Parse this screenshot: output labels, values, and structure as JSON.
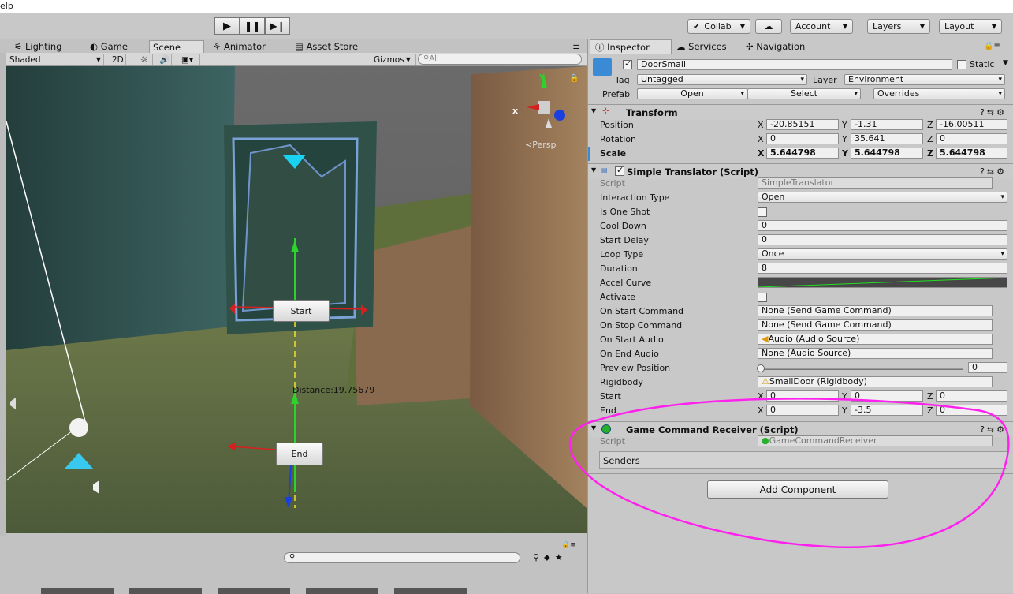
{
  "menubar": {
    "fragment": "elp"
  },
  "toolbar": {
    "collab": "Collab",
    "account": "Account",
    "layers": "Layers",
    "layout": "Layout"
  },
  "scene_tabs": [
    {
      "label": "Lighting"
    },
    {
      "label": "Game"
    },
    {
      "label": "Scene"
    },
    {
      "label": "Animator"
    },
    {
      "label": "Asset Store"
    }
  ],
  "scene_bar": {
    "shading": "Shaded",
    "mode_2d": "2D",
    "gizmos": "Gizmos",
    "search_placeholder": "All"
  },
  "viewport": {
    "persp": "Persp",
    "start_label": "Start",
    "end_label": "End",
    "distance": "Distance:19.75679",
    "gizmo_x": "x",
    "gizmo_y": "y"
  },
  "inspector_tabs": [
    {
      "label": "Inspector"
    },
    {
      "label": "Services"
    },
    {
      "label": "Navigation"
    }
  ],
  "object": {
    "name": "DoorSmall",
    "static_label": "Static",
    "tag_label": "Tag",
    "tag": "Untagged",
    "layer_label": "Layer",
    "layer": "Environment",
    "prefab_label": "Prefab",
    "open": "Open",
    "select": "Select",
    "overrides": "Overrides"
  },
  "transform": {
    "title": "Transform",
    "position_label": "Position",
    "rotation_label": "Rotation",
    "scale_label": "Scale",
    "position": {
      "x": "-20.85151",
      "y": "-1.31",
      "z": "-16.00511"
    },
    "rotation": {
      "x": "0",
      "y": "35.641",
      "z": "0"
    },
    "scale": {
      "x": "5.644798",
      "y": "5.644798",
      "z": "5.644798"
    }
  },
  "translator": {
    "title": "Simple Translator (Script)",
    "script_label": "Script",
    "script": "SimpleTranslator",
    "interaction_type_label": "Interaction Type",
    "interaction_type": "Open",
    "is_one_shot_label": "Is One Shot",
    "cool_down_label": "Cool Down",
    "cool_down": "0",
    "start_delay_label": "Start Delay",
    "start_delay": "0",
    "loop_type_label": "Loop Type",
    "loop_type": "Once",
    "duration_label": "Duration",
    "duration": "8",
    "accel_curve_label": "Accel Curve",
    "activate_label": "Activate",
    "on_start_command_label": "On Start Command",
    "on_start_command": "None (Send Game Command)",
    "on_stop_command_label": "On Stop Command",
    "on_stop_command": "None (Send Game Command)",
    "on_start_audio_label": "On Start Audio",
    "on_start_audio": "Audio (Audio Source)",
    "on_end_audio_label": "On End Audio",
    "on_end_audio": "None (Audio Source)",
    "preview_position_label": "Preview Position",
    "preview_position": "0",
    "rigidbody_label": "Rigidbody",
    "rigidbody": "SmallDoor (Rigidbody)",
    "start_label": "Start",
    "start": {
      "x": "0",
      "y": "0",
      "z": "0"
    },
    "end_label": "End",
    "end": {
      "x": "0",
      "y": "-3.5",
      "z": "0"
    }
  },
  "receiver": {
    "title": "Game Command Receiver (Script)",
    "script_label": "Script",
    "script": "GameCommandReceiver",
    "senders": "Senders"
  },
  "add_component": "Add Component",
  "axis_labels": {
    "x": "X",
    "y": "Y",
    "z": "Z"
  },
  "colors": {
    "annotation": "#ff22ee",
    "gizmo_x": "#d62020",
    "gizmo_y": "#2dd22d",
    "gizmo_z": "#1a3fe0"
  }
}
